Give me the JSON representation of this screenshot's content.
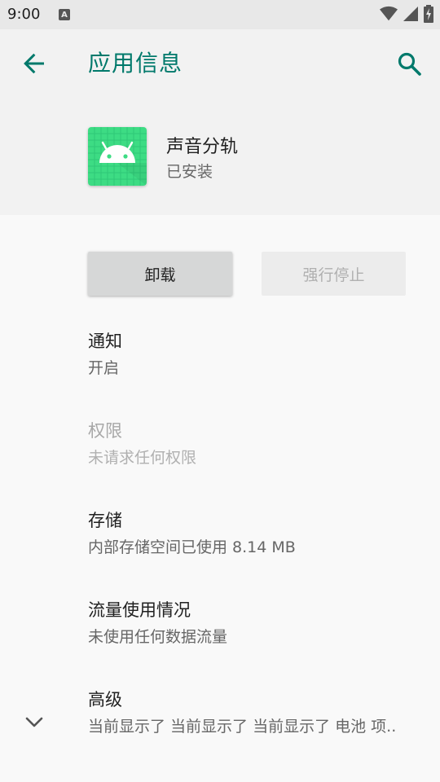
{
  "status_bar": {
    "time": "9:00",
    "a_badge": "A"
  },
  "app_bar": {
    "title": "应用信息"
  },
  "app": {
    "name": "声音分轨",
    "status": "已安装"
  },
  "buttons": {
    "uninstall": "卸载",
    "force_stop": "强行停止"
  },
  "settings": [
    {
      "title": "通知",
      "subtitle": "开启"
    },
    {
      "title": "权限",
      "subtitle": "未请求任何权限"
    },
    {
      "title": "存储",
      "subtitle": "内部存储空间已使用 8.14 MB"
    },
    {
      "title": "流量使用情况",
      "subtitle": "未使用任何数据流量"
    },
    {
      "title": "高级",
      "subtitle": "当前显示了 当前显示了 当前显示了 电池 项.."
    }
  ],
  "colors": {
    "accent": "#00796b",
    "app_icon_bg": "#3ddc84"
  }
}
